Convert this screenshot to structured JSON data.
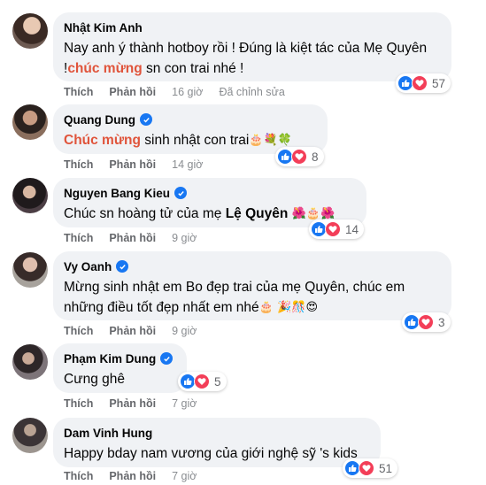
{
  "comments": [
    {
      "name": "Nhật Kim Anh",
      "verified": false,
      "text_parts": [
        "Nay anh ý thành hotboy rồi ! Đúng là kiệt tác của Mẹ Quyên !",
        "chúc mừng",
        " sn con trai nhé !"
      ],
      "reaction_count": "57",
      "like_label": "Thích",
      "reply_label": "Phản hồi",
      "time": "16 giờ",
      "edited": "Đã chỉnh sửa"
    },
    {
      "name": "Quang Dung",
      "verified": true,
      "text_parts": [
        "Chúc mừng",
        " sinh nhật con trai"
      ],
      "emojis": [
        "🎂",
        "💐",
        "🍀"
      ],
      "reaction_count": "8",
      "like_label": "Thích",
      "reply_label": "Phản hồi",
      "time": "14 giờ"
    },
    {
      "name": "Nguyen Bang Kieu",
      "verified": true,
      "text_parts": [
        "Chúc sn hoàng tử của mẹ ",
        "Lệ Quyên"
      ],
      "emojis": [
        "🌺",
        "🎂",
        "🌺"
      ],
      "reaction_count": "14",
      "like_label": "Thích",
      "reply_label": "Phản hồi",
      "time": "9 giờ"
    },
    {
      "name": "Vy Oanh",
      "verified": true,
      "text_parts": [
        "Mừng sinh nhật em Bo đẹp trai của mẹ Quyên, chúc em những điều tốt đẹp nhất em nhé"
      ],
      "emojis": [
        "🎂",
        "🎉",
        "🎊",
        "😍"
      ],
      "reaction_count": "3",
      "like_label": "Thích",
      "reply_label": "Phản hồi",
      "time": "9 giờ"
    },
    {
      "name": "Phạm Kim Dung",
      "verified": true,
      "text_parts": [
        "Cưng ghê"
      ],
      "reaction_count": "5",
      "like_label": "Thích",
      "reply_label": "Phản hồi",
      "time": "7 giờ"
    },
    {
      "name": "Dam Vinh Hung",
      "verified": false,
      "text_parts": [
        "Happy bday nam vương của giới nghệ sỹ 's kids"
      ],
      "reaction_count": "51",
      "like_label": "Thích",
      "reply_label": "Phản hồi",
      "time": "7 giờ"
    }
  ],
  "colors": {
    "bubble_bg": "#f0f2f5",
    "highlight": "#e0543b",
    "like_blue": "#1877f2",
    "love_red": "#f33e58",
    "meta_gray": "#65676b"
  },
  "icons": [
    "verified-badge-icon",
    "like-reaction-icon",
    "love-reaction-icon"
  ]
}
